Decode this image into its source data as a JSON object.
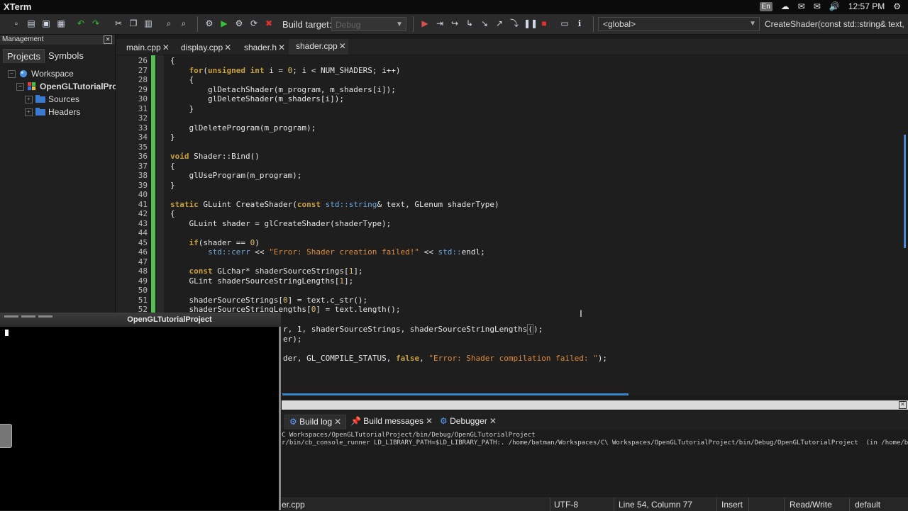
{
  "os_bar": {
    "app_title": "XTerm",
    "lang": "En",
    "time": "12:57 PM"
  },
  "toolbar": {
    "build_target_label": "Build target:",
    "build_target_value": "Debug",
    "scope_value": "<global>",
    "function_value": "CreateShader(const std::string& text,"
  },
  "management": {
    "title": "Management",
    "tabs": [
      "Projects",
      "Symbols"
    ],
    "tree": {
      "workspace": "Workspace",
      "project": "OpenGLTutorialProj",
      "folders": [
        "Sources",
        "Headers"
      ]
    }
  },
  "editor": {
    "tabs": [
      "main.cpp",
      "display.cpp",
      "shader.h",
      "shader.cpp"
    ],
    "active_tab": "shader.cpp",
    "line_numbers": [
      "26",
      "27",
      "28",
      "29",
      "30",
      "31",
      "32",
      "33",
      "34",
      "35",
      "36",
      "37",
      "38",
      "39",
      "40",
      "41",
      "42",
      "43",
      "44",
      "45",
      "46",
      "47",
      "48",
      "49",
      "50",
      "51",
      "52"
    ],
    "partial_lines": {
      "l53": "r, 1, shaderSourceStrings, shaderSourceStringLengths",
      "l53_end": ");",
      "l54": "er);",
      "l56a": "der, GL_COMPILE_STATUS, ",
      "l56b": "false",
      "l56c": ", ",
      "l56d": "\"Error: Shader compilation failed: \"",
      "l56e": ");"
    }
  },
  "logs": {
    "tabs": [
      "Build log",
      "Build messages",
      "Debugger"
    ],
    "lines": [
      "C Workspaces/OpenGLTutorialProject/bin/Debug/OpenGLTutorialProject",
      "r/bin/cb_console_runner LD_LIBRARY_PATH=$LD_LIBRARY_PATH:. /home/batman/Workspaces/C\\ Workspaces/OpenGLTutorialProject/bin/Debug/OpenGLTutorialProject  (in /home/batman/Workspaces/C"
    ]
  },
  "statusbar": {
    "file": "er.cpp",
    "encoding": "UTF-8",
    "position": "Line 54, Column 77",
    "mode": "Insert",
    "access": "Read/Write",
    "profile": "default"
  },
  "xterm": {
    "title": "OpenGLTutorialProject"
  }
}
